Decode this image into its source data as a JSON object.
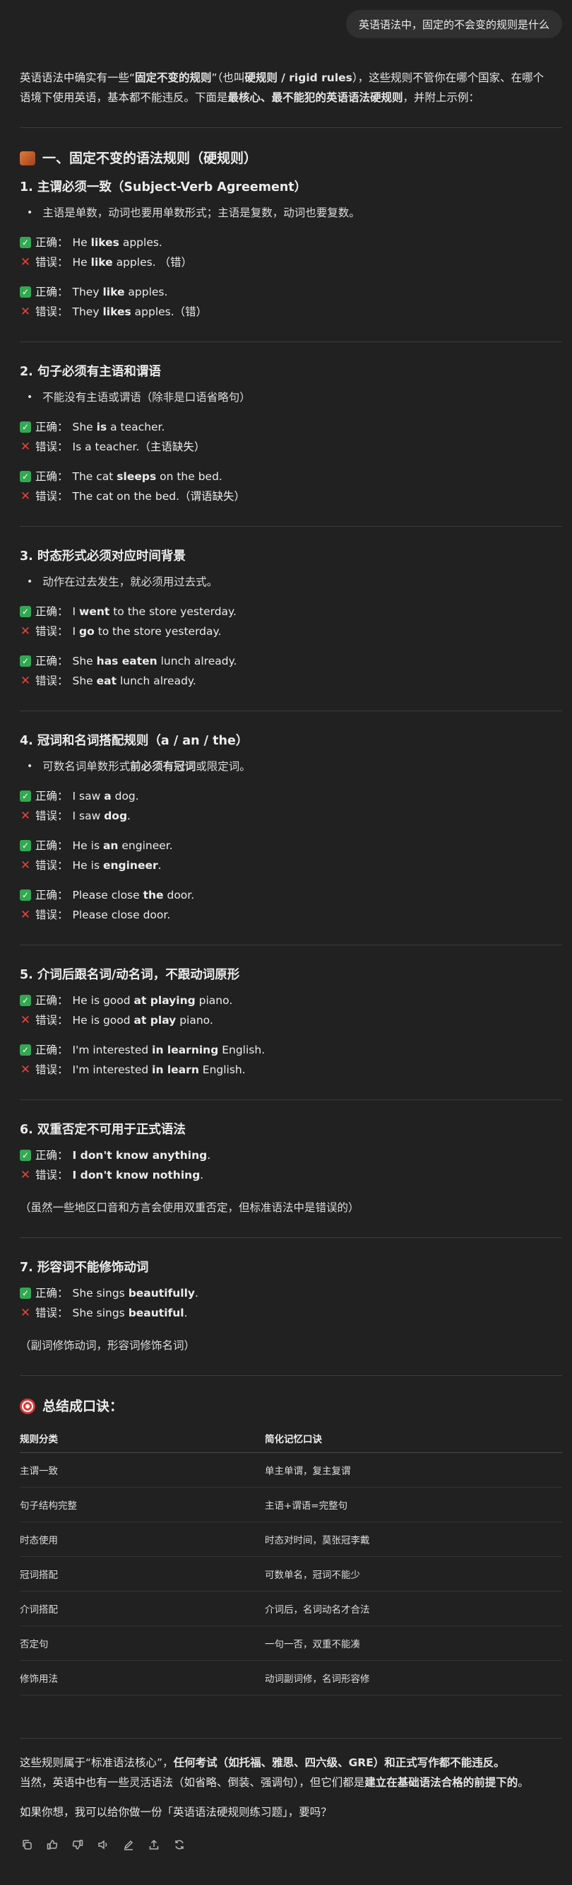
{
  "user_message": "英语语法中，固定的不会变的规则是什么",
  "intro": {
    "line1_a": "英语语法中确实有一些“",
    "line1_b": "固定不变的规则",
    "line1_c": "”（也叫",
    "line1_d": "硬规则 / rigid rules",
    "line1_e": "），这些规则不管你在哪个国家、在哪个",
    "line2_a": "语境下使用英语，基本都不能违反。下面是",
    "line2_b": "最核心、最不能犯的英语语法硬规则",
    "line2_c": "，并附上示例："
  },
  "section_title": "一、固定不变的语法规则（硬规则）",
  "labels": {
    "correct": "正确：",
    "wrong": "错误："
  },
  "rule1": {
    "title": "1. 主谓必须一致（Subject-Verb Agreement）",
    "bullet": "主语是单数，动词也要用单数形式；主语是复数，动词也要复数。",
    "e1_ok": [
      "He ",
      "likes",
      " apples."
    ],
    "e1_bad": [
      "He ",
      "like",
      " apples. （错）"
    ],
    "e2_ok": [
      "They ",
      "like",
      " apples."
    ],
    "e2_bad": [
      "They ",
      "likes",
      " apples.（错）"
    ]
  },
  "rule2": {
    "title": "2. 句子必须有主语和谓语",
    "bullet": "不能没有主语或谓语（除非是口语省略句）",
    "e1_ok": [
      "She ",
      "is",
      " a teacher."
    ],
    "e1_bad": "Is a teacher.（主语缺失）",
    "e2_ok": [
      "The cat ",
      "sleeps",
      " on the bed."
    ],
    "e2_bad": "The cat on the bed.（谓语缺失）"
  },
  "rule3": {
    "title": "3. 时态形式必须对应时间背景",
    "bullet": "动作在过去发生，就必须用过去式。",
    "e1_ok": [
      "I ",
      "went",
      " to the store yesterday."
    ],
    "e1_bad": [
      "I ",
      "go",
      " to the store yesterday."
    ],
    "e2_ok": [
      "She ",
      "has eaten",
      " lunch already."
    ],
    "e2_bad": [
      "She ",
      "eat",
      " lunch already."
    ]
  },
  "rule4": {
    "title": "4. 冠词和名词搭配规则（a / an / the）",
    "bullet_a": "可数名词单数形式",
    "bullet_b": "前必须有冠词",
    "bullet_c": "或限定词。",
    "e1_ok": [
      "I saw ",
      "a",
      " dog."
    ],
    "e1_bad": [
      "I saw ",
      "dog",
      "."
    ],
    "e2_ok": [
      "He is ",
      "an",
      " engineer."
    ],
    "e2_bad": [
      "He is ",
      "engineer",
      "."
    ],
    "e3_ok": [
      "Please close ",
      "the",
      " door."
    ],
    "e3_bad": "Please close door."
  },
  "rule5": {
    "title": "5. 介词后跟名词/动名词，不跟动词原形",
    "e1_ok": [
      "He is good ",
      "at playing",
      " piano."
    ],
    "e1_bad": [
      "He is good ",
      "at play",
      " piano."
    ],
    "e2_ok": [
      "I'm interested ",
      "in learning",
      " English."
    ],
    "e2_bad": [
      "I'm interested ",
      "in learn",
      " English."
    ]
  },
  "rule6": {
    "title": "6. 双重否定不可用于正式语法",
    "e1_ok": [
      "",
      "I don't know anything",
      "."
    ],
    "e1_bad": [
      "",
      "I don't know nothing",
      "."
    ],
    "note": "（虽然一些地区口音和方言会使用双重否定，但标准语法中是错误的）"
  },
  "rule7": {
    "title": "7. 形容词不能修饰动词",
    "e1_ok": [
      "She sings ",
      "beautifully",
      "."
    ],
    "e1_bad": [
      "She sings ",
      "beautiful",
      "."
    ],
    "note": "（副词修饰动词，形容词修饰名词）"
  },
  "summary": {
    "title": "总结成口诀：",
    "headers": [
      "规则分类",
      "简化记忆口诀"
    ],
    "rows": [
      [
        "主谓一致",
        "单主单谓，复主复谓"
      ],
      [
        "句子结构完整",
        "主语+谓语=完整句"
      ],
      [
        "时态使用",
        "时态对时间，莫张冠李戴"
      ],
      [
        "冠词搭配",
        "可数单名，冠词不能少"
      ],
      [
        "介词搭配",
        "介词后，名词动名才合法"
      ],
      [
        "否定句",
        "一句一否，双重不能凑"
      ],
      [
        "修饰用法",
        "动词副词修，名词形容修"
      ]
    ]
  },
  "closing": {
    "l1_a": "这些规则属于“标准语法核心”，",
    "l1_b": "任何考试（如托福、雅思、四六级、GRE）和正式写作都不能违反。",
    "l2_a": "当然，英语中也有一些灵活语法（如省略、倒装、强调句），但它们都是",
    "l2_b": "建立在基础语法合格的前提下的",
    "l2_c": "。",
    "l3": "如果你想，我可以给你做一份「英语语法硬规则练习题」，要吗？"
  },
  "icons": {
    "section": "fire-icon",
    "summary": "target-icon",
    "correct": "check-icon",
    "wrong": "cross-icon",
    "actions": [
      "copy-icon",
      "thumbs-up-icon",
      "thumbs-down-icon",
      "speaker-icon",
      "edit-icon",
      "share-icon",
      "regenerate-icon"
    ]
  },
  "colors": {
    "background": "#212121",
    "bubble": "#303030",
    "correct": "#33a853",
    "wrong": "#e3453c"
  }
}
